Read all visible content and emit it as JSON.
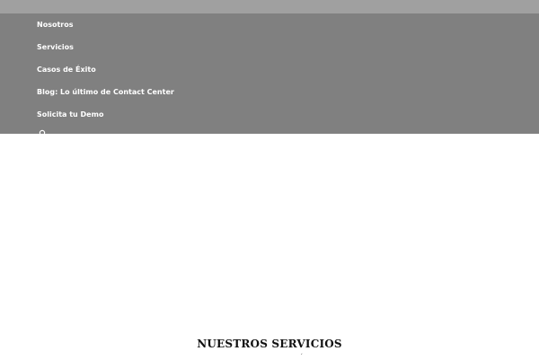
{
  "nav": {
    "items": [
      {
        "label": "Nosotros"
      },
      {
        "label": "Servicios"
      },
      {
        "label": "Casos de Éxito"
      },
      {
        "label": "Blog: Lo último de Contact Center"
      },
      {
        "label": "Solicita tu Demo"
      }
    ],
    "search_icon": "search-icon"
  },
  "main": {
    "section_title": "NUESTROS SERVICIOS"
  },
  "colors": {
    "menu_bg": "#808080",
    "top_strip": "#a0a0a0",
    "menu_text": "#ffffff"
  }
}
